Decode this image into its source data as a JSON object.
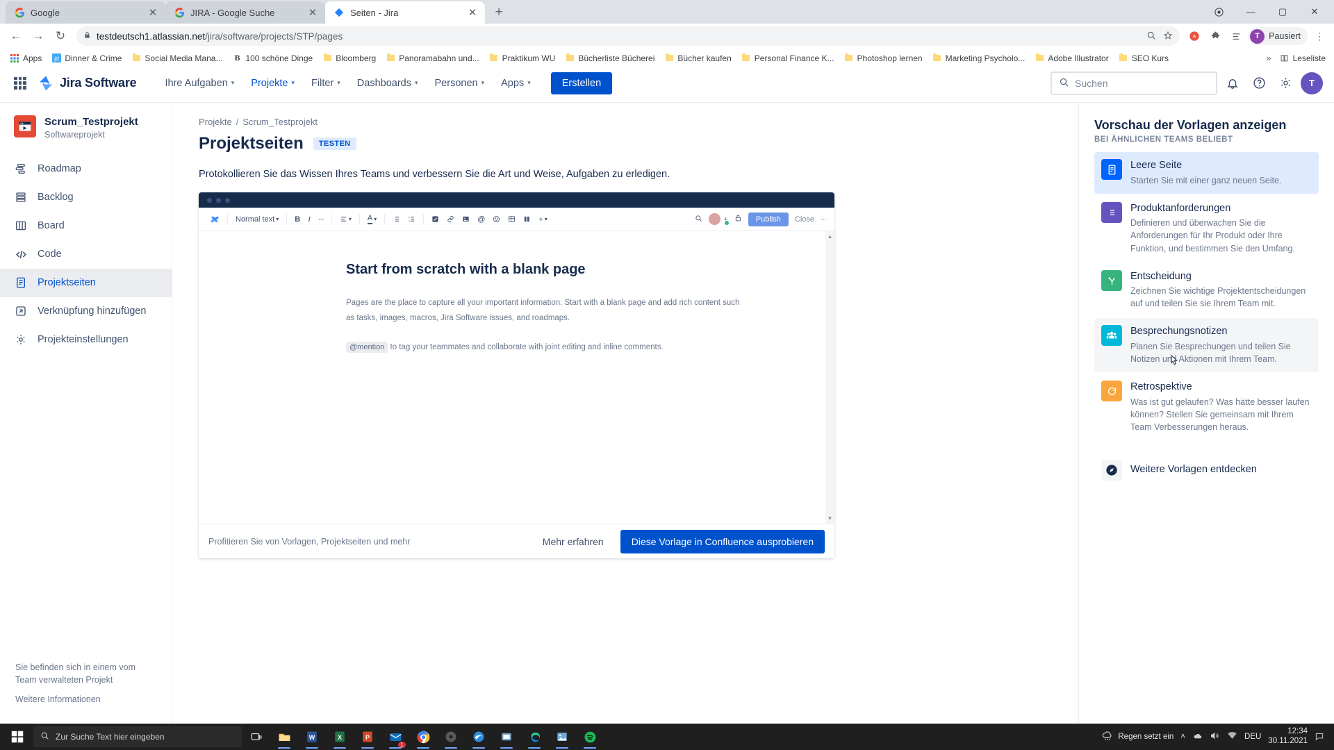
{
  "browser": {
    "tabs": [
      {
        "title": "Google",
        "favicon": "google-icon",
        "active": false
      },
      {
        "title": "JIRA - Google Suche",
        "favicon": "google-icon",
        "active": false
      },
      {
        "title": "Seiten - Jira",
        "favicon": "jira-icon",
        "active": true
      }
    ],
    "newtab_label": "+",
    "nav": {
      "back": "←",
      "forward": "→",
      "reload": "↻"
    },
    "omnibox": {
      "lock": "lock-icon",
      "host": "testdeutsch1.atlassian.net",
      "path": "/jira/software/projects/STP/pages",
      "zoom_icon": "zoom-icon",
      "star_icon": "star-icon"
    },
    "profile": {
      "label": "Pausiert",
      "initial": "T"
    },
    "bookmarks": [
      {
        "label": "Apps",
        "icon": "apps-grid-icon"
      },
      {
        "label": "Dinner & Crime",
        "icon": "jd-icon"
      },
      {
        "label": "Social Media Mana...",
        "icon": "folder-icon"
      },
      {
        "label": "100 schöne Dinge",
        "icon": "b-icon"
      },
      {
        "label": "Bloomberg",
        "icon": "folder-icon"
      },
      {
        "label": "Panoramabahn und...",
        "icon": "folder-icon"
      },
      {
        "label": "Praktikum WU",
        "icon": "folder-icon"
      },
      {
        "label": "Bücherliste Bücherei",
        "icon": "folder-icon"
      },
      {
        "label": "Bücher kaufen",
        "icon": "folder-icon"
      },
      {
        "label": "Personal Finance K...",
        "icon": "folder-icon"
      },
      {
        "label": "Photoshop lernen",
        "icon": "folder-icon"
      },
      {
        "label": "Marketing Psycholo...",
        "icon": "folder-icon"
      },
      {
        "label": "Adobe Illustrator",
        "icon": "folder-icon"
      },
      {
        "label": "SEO Kurs",
        "icon": "folder-icon"
      }
    ],
    "bookmarks_overflow": "»",
    "reading_list": "Leseliste"
  },
  "jira_nav": {
    "product_name": "Jira Software",
    "items": [
      {
        "label": "Ihre Aufgaben",
        "caret": true,
        "active": false
      },
      {
        "label": "Projekte",
        "caret": true,
        "active": true
      },
      {
        "label": "Filter",
        "caret": true,
        "active": false
      },
      {
        "label": "Dashboards",
        "caret": true,
        "active": false
      },
      {
        "label": "Personen",
        "caret": true,
        "active": false
      },
      {
        "label": "Apps",
        "caret": true,
        "active": false
      }
    ],
    "create_label": "Erstellen",
    "search_placeholder": "Suchen",
    "avatar_initial": "T"
  },
  "sidebar": {
    "project_name": "Scrum_Testprojekt",
    "project_type": "Softwareprojekt",
    "items": [
      {
        "label": "Roadmap",
        "icon": "roadmap-icon",
        "active": false
      },
      {
        "label": "Backlog",
        "icon": "backlog-icon",
        "active": false
      },
      {
        "label": "Board",
        "icon": "board-icon",
        "active": false
      },
      {
        "label": "Code",
        "icon": "code-icon",
        "active": false
      },
      {
        "label": "Projektseiten",
        "icon": "pages-icon",
        "active": true
      },
      {
        "label": "Verknüpfung hinzufügen",
        "icon": "add-shortcut-icon",
        "active": false
      },
      {
        "label": "Projekteinstellungen",
        "icon": "settings-icon",
        "active": false
      }
    ],
    "footer_note": "Sie befinden sich in einem vom Team verwalteten Projekt",
    "footer_link": "Weitere Informationen"
  },
  "main": {
    "breadcrumb": {
      "root": "Projekte",
      "sep": "/",
      "current": "Scrum_Testprojekt"
    },
    "page_title": "Projektseiten",
    "badge": "TESTEN",
    "lede": "Protokollieren Sie das Wissen Ihres Teams und verbessern Sie die Art und Weise, Aufgaben zu erledigen.",
    "preview": {
      "toolbar": {
        "style_select": "Normal text",
        "bold": "B",
        "italic": "I",
        "more": "···",
        "publish": "Publish",
        "close": "Close",
        "overflow": "···"
      },
      "doc_title": "Start from scratch with a blank page",
      "doc_p1": "Pages are the place to capture all your important information. Start with a blank page and add rich content such as tasks, images, macros, Jira Software issues, and roadmaps.",
      "mention_chip": "@mention",
      "doc_p2": "to tag your teammates and collaborate with joint editing and inline comments."
    },
    "footer": {
      "note": "Profitieren Sie von Vorlagen, Projektseiten und mehr",
      "learn_more": "Mehr erfahren",
      "cta": "Diese Vorlage in Confluence ausprobieren"
    }
  },
  "templates_panel": {
    "heading": "Vorschau der Vorlagen anzeigen",
    "subheading": "BEI ÄHNLICHEN TEAMS BELIEBT",
    "items": [
      {
        "title": "Leere Seite",
        "desc": "Starten Sie mit einer ganz neuen Seite.",
        "icon": "blank-page-icon",
        "color": "#0065ff",
        "state": "selected"
      },
      {
        "title": "Produktanforderungen",
        "desc": "Definieren und überwachen Sie die Anforderungen für Ihr Produkt oder Ihre Funktion, und bestimmen Sie den Umfang.",
        "icon": "list-icon",
        "color": "#6554c0",
        "state": "normal"
      },
      {
        "title": "Entscheidung",
        "desc": "Zeichnen Sie wichtige Projektentscheidungen auf und teilen Sie sie Ihrem Team mit.",
        "icon": "branch-icon",
        "color": "#36b37e",
        "state": "normal"
      },
      {
        "title": "Besprechungsnotizen",
        "desc": "Planen Sie Besprechungen und teilen Sie Notizen und Aktionen mit Ihrem Team.",
        "icon": "people-icon",
        "color": "#00b8d9",
        "state": "hover"
      },
      {
        "title": "Retrospektive",
        "desc": "Was ist gut gelaufen? Was hätte besser laufen können? Stellen Sie gemeinsam mit Ihrem Team Verbesserungen heraus.",
        "icon": "retro-icon",
        "color": "#faa53d",
        "state": "normal"
      }
    ],
    "discover": {
      "title": "Weitere Vorlagen entdecken",
      "icon": "compass-icon"
    }
  },
  "taskbar": {
    "search_placeholder": "Zur Suche Text hier eingeben",
    "apps": [
      {
        "name": "task-view-icon"
      },
      {
        "name": "file-explorer-icon"
      },
      {
        "name": "word-icon"
      },
      {
        "name": "excel-icon"
      },
      {
        "name": "powerpoint-icon"
      },
      {
        "name": "outlook-icon",
        "badge": "1"
      },
      {
        "name": "chrome-icon"
      },
      {
        "name": "dvd-icon"
      },
      {
        "name": "edge-legacy-icon"
      },
      {
        "name": "snip-icon"
      },
      {
        "name": "edge-icon"
      },
      {
        "name": "photos-icon"
      },
      {
        "name": "spotify-icon"
      }
    ],
    "weather": "Regen setzt ein",
    "language": "DEU",
    "time": "12:34",
    "date": "30.11.2021"
  },
  "colors": {
    "jira_blue": "#0052cc",
    "jira_link": "#0065ff",
    "text_dark": "#172b4d",
    "text_sub": "#6b778c",
    "highlight": "#deebff"
  }
}
